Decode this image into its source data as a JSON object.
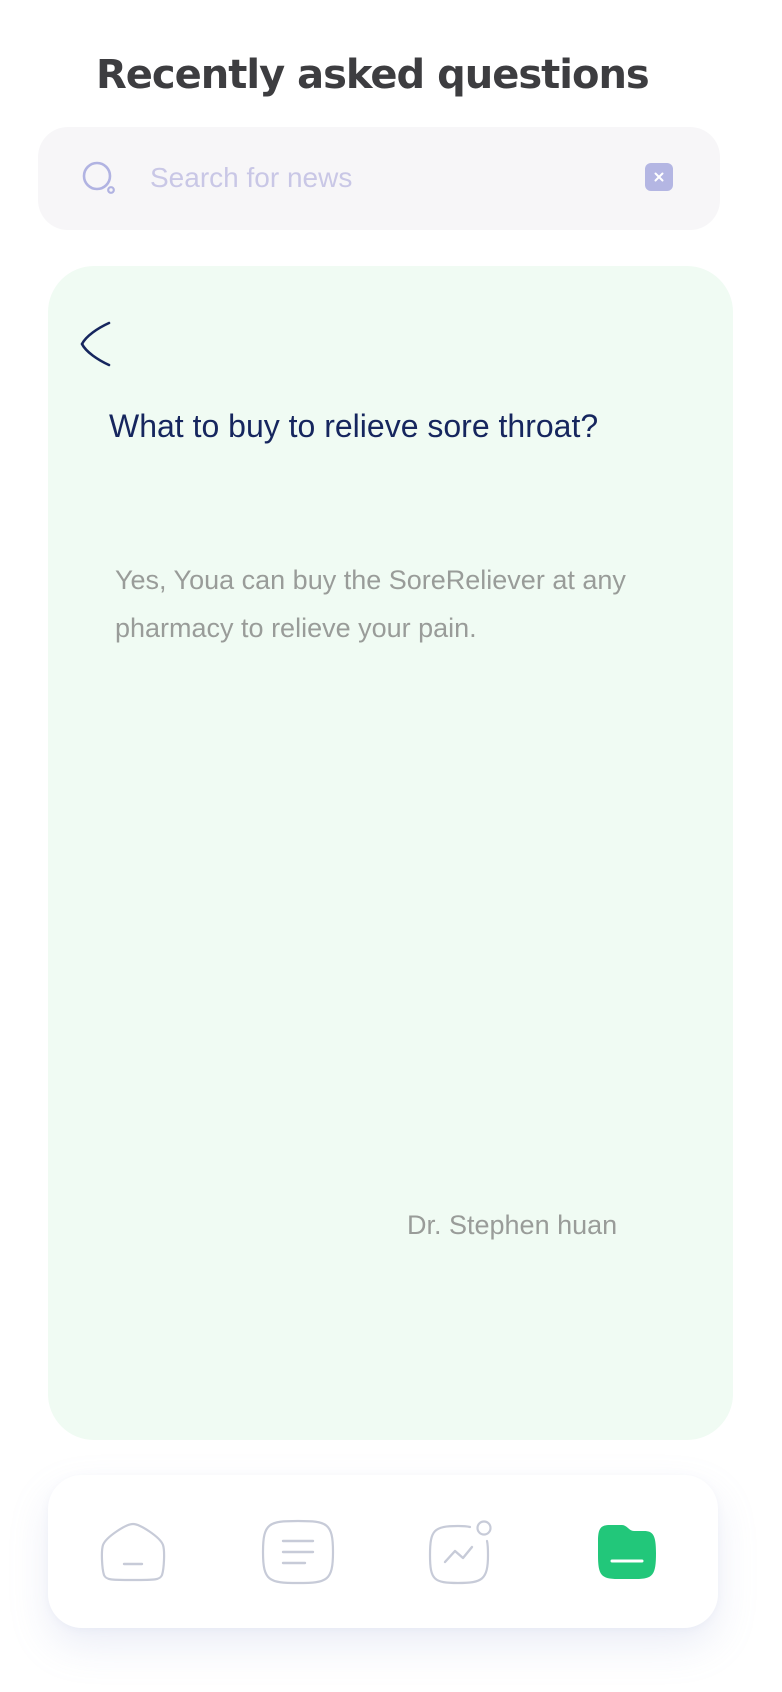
{
  "page": {
    "title": "Recently asked questions"
  },
  "search": {
    "placeholder": "Search for news",
    "value": "",
    "icon": "search-icon",
    "clear_icon": "close-icon"
  },
  "qa_card": {
    "back_icon": "chevron-left-icon",
    "question": "What to buy to relieve sore throat?",
    "answer": "Yes,  Youa can buy the SoreReliever at any pharmacy to relieve your pain.",
    "author": "Dr. Stephen huan",
    "background": "#f0fbf3"
  },
  "tab_bar": {
    "tabs": [
      {
        "icon": "home-icon",
        "active": false
      },
      {
        "icon": "news-icon",
        "active": false
      },
      {
        "icon": "activity-chart-icon",
        "active": false
      },
      {
        "icon": "folder-icon",
        "active": true
      }
    ],
    "active_color": "#22c77a",
    "inactive_color": "#c7cbd8"
  },
  "colors": {
    "title": "#3d3d40",
    "question": "#16265e",
    "body_text": "#999c99",
    "search_icon": "#b1b3e2"
  }
}
